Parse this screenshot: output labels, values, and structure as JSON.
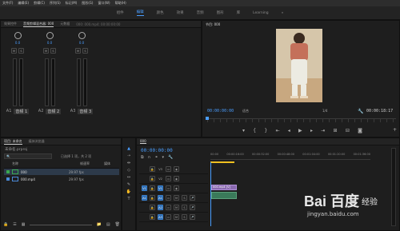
{
  "menu": [
    "文件(F)",
    "编辑(E)",
    "剪辑(C)",
    "序列(S)",
    "标记(M)",
    "图形(G)",
    "窗口(W)",
    "帮助(H)"
  ],
  "workspaces": [
    "组件",
    "编辑",
    "颜色",
    "效果",
    "音频",
    "图形",
    "库",
    "Learning"
  ],
  "workspace_overflow": "»",
  "mixer": {
    "tabs": [
      "效果控件",
      "音频剪辑混合器: 000",
      "元数据"
    ],
    "active_tab": 1,
    "clip_info": "000: 000.mp4: 00:00:00:00",
    "channels": [
      {
        "id": "A1",
        "name": "音频 1"
      },
      {
        "id": "A2",
        "name": "音频 2"
      },
      {
        "id": "A3",
        "name": "音频 3"
      }
    ],
    "pan_value": "0.0"
  },
  "program": {
    "title": "节目: 000",
    "timecode": "00:00:00:00",
    "fit": "适合",
    "quality": "1/4",
    "duration": "00:00:18:17"
  },
  "project": {
    "tabs": [
      "项目: 未命名",
      "媒体浏览器"
    ],
    "file_name": "未命名.prproj",
    "item_count": "已选择 1 项，共 2 项",
    "columns": [
      "名称",
      "帧速率",
      "媒体"
    ],
    "items": [
      {
        "name": "000",
        "fps": "29.97 fps",
        "color": "#3aa850"
      },
      {
        "name": "000.mp4",
        "fps": "29.97 fps",
        "color": "#4a8ad8"
      }
    ]
  },
  "timeline": {
    "tab": "000",
    "timecode": "00:00:00:00",
    "ruler": [
      "00:00",
      "00:00:16:00",
      "00:00:32:00",
      "00:00:48:00",
      "00:01:04:00",
      "00:01:20:00",
      "00:01:36:00"
    ],
    "video_tracks": [
      "V3",
      "V2",
      "V1"
    ],
    "audio_tracks": [
      "A1",
      "A2",
      "A3"
    ],
    "clip_label": "000.mp4 [V]",
    "source_patch": [
      "V1",
      "A1"
    ]
  },
  "watermark": {
    "brand": "Bai 百度",
    "sub": "经验",
    "url": "jingyan.baidu.com"
  },
  "colors": {
    "accent": "#4a9eff",
    "video_clip": "#8a6ab0",
    "audio_clip": "#3a7a5a",
    "playhead": "#f0c020"
  }
}
